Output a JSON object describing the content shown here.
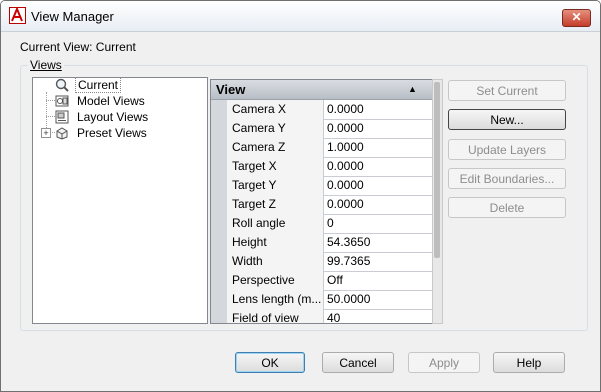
{
  "window": {
    "title": "View Manager",
    "close_label": "✕"
  },
  "current_view": "Current View: Current",
  "views_group_label": "Views",
  "tree": {
    "items": [
      {
        "label": "Current",
        "icon": "magnifier-icon",
        "selected": true
      },
      {
        "label": "Model Views",
        "icon": "model-views-icon"
      },
      {
        "label": "Layout Views",
        "icon": "layout-views-icon"
      },
      {
        "label": "Preset Views",
        "icon": "preset-views-icon",
        "expander": "+"
      }
    ]
  },
  "properties": {
    "header": "View",
    "sort_arrow": "▲",
    "rows": [
      {
        "name": "Camera X",
        "value": "0.0000"
      },
      {
        "name": "Camera Y",
        "value": "0.0000"
      },
      {
        "name": "Camera Z",
        "value": "1.0000"
      },
      {
        "name": "Target X",
        "value": "0.0000"
      },
      {
        "name": "Target Y",
        "value": "0.0000"
      },
      {
        "name": "Target Z",
        "value": "0.0000"
      },
      {
        "name": "Roll angle",
        "value": "0"
      },
      {
        "name": "Height",
        "value": "54.3650"
      },
      {
        "name": "Width",
        "value": "99.7365"
      },
      {
        "name": "Perspective",
        "value": "Off"
      },
      {
        "name": "Lens length (m...",
        "value": "50.0000"
      },
      {
        "name": "Field of view",
        "value": "40"
      }
    ]
  },
  "side_buttons": {
    "set_current": "Set Current",
    "new": "New...",
    "update_layers": "Update Layers",
    "edit_boundaries": "Edit Boundaries...",
    "delete": "Delete"
  },
  "bottom_buttons": {
    "ok": "OK",
    "cancel": "Cancel",
    "apply": "Apply",
    "help": "Help"
  },
  "colors": {
    "close": "#c43d2a",
    "header": "#b8bec6",
    "focus": "#3c7fb1"
  }
}
